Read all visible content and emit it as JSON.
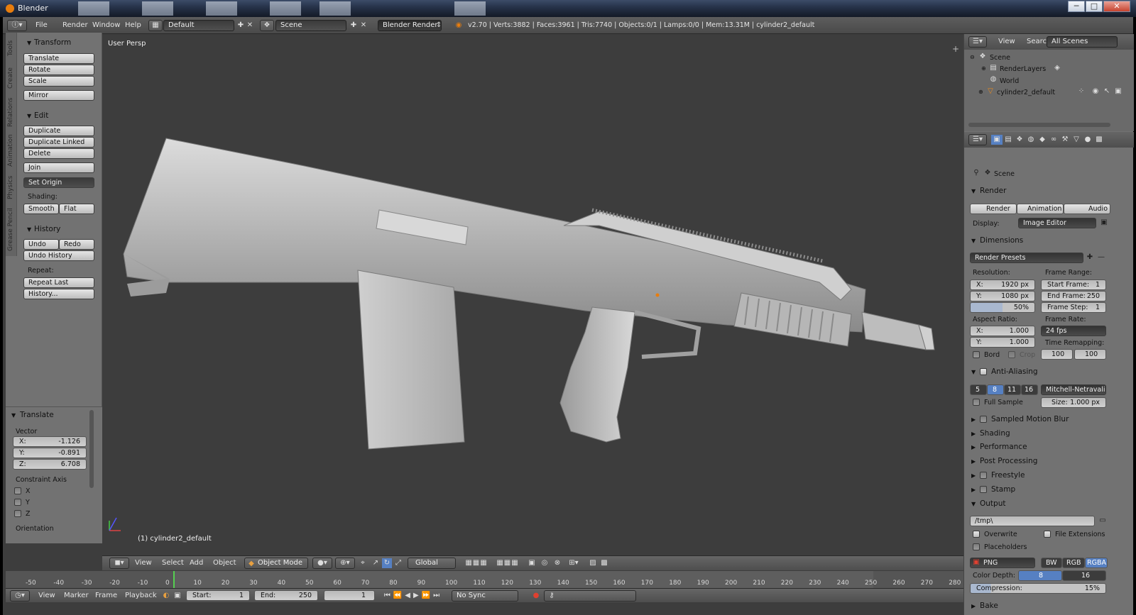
{
  "window": {
    "title": "Blender",
    "min": "─",
    "max": "□",
    "close": "✕"
  },
  "info": {
    "menus": [
      "File",
      "Render",
      "Window",
      "Help"
    ],
    "layout": "Default",
    "scene": "Scene",
    "engine": "Blender Render",
    "stats": "v2.70 | Verts:3882 | Faces:3961 | Tris:7740 | Objects:0/1 | Lamps:0/0 | Mem:13.31M | cylinder2_default"
  },
  "toolshelf": {
    "tabs": [
      "Tools",
      "Create",
      "Relations",
      "Animation",
      "Physics",
      "Grease Pencil"
    ],
    "transform": {
      "title": "Transform",
      "buttons": [
        "Translate",
        "Rotate",
        "Scale",
        "Mirror"
      ]
    },
    "edit": {
      "title": "Edit",
      "buttons": [
        "Duplicate",
        "Duplicate Linked",
        "Delete",
        "Join"
      ],
      "set_origin": "Set Origin",
      "shading_label": "Shading:",
      "smooth": "Smooth",
      "flat": "Flat"
    },
    "history": {
      "title": "History",
      "undo": "Undo",
      "redo": "Redo",
      "undo_history": "Undo History",
      "repeat_label": "Repeat:",
      "repeat_last": "Repeat Last",
      "history": "History..."
    }
  },
  "operator": {
    "title": "Translate",
    "vector_label": "Vector",
    "x": "X:",
    "xv": "-1.126",
    "y": "Y:",
    "yv": "-0.891",
    "z": "Z:",
    "zv": "6.708",
    "constraint_label": "Constraint Axis",
    "axes": [
      "X",
      "Y",
      "Z"
    ],
    "orientation": "Orientation"
  },
  "viewport": {
    "label": "User Persp",
    "object": "(1) cylinder2_default"
  },
  "viewheader": {
    "view": "View",
    "select": "Select",
    "add": "Add",
    "object": "Object",
    "mode": "Object Mode",
    "orientation": "Global"
  },
  "timeline": {
    "ticks": [
      "-50",
      "-40",
      "-30",
      "-20",
      "-10",
      "0",
      "10",
      "20",
      "30",
      "40",
      "50",
      "60",
      "70",
      "80",
      "90",
      "100",
      "110",
      "120",
      "130",
      "140",
      "150",
      "160",
      "170",
      "180",
      "190",
      "200",
      "210",
      "220",
      "230",
      "240",
      "250",
      "260",
      "270",
      "280"
    ],
    "view": "View",
    "marker": "Marker",
    "frame": "Frame",
    "playback": "Playback",
    "start": "Start:",
    "start_v": "1",
    "end": "End:",
    "end_v": "250",
    "current": "1",
    "sync": "No Sync"
  },
  "outliner": {
    "view": "View",
    "search": "Search",
    "scenes": "All Scenes",
    "items": [
      "Scene",
      "RenderLayers",
      "World",
      "cylinder2_default"
    ]
  },
  "properties": {
    "context": "Scene",
    "render": {
      "title": "Render",
      "render": "Render",
      "animation": "Animation",
      "audio": "Audio",
      "display_label": "Display:",
      "display": "Image Editor"
    },
    "dimensions": {
      "title": "Dimensions",
      "presets": "Render Presets",
      "resolution": "Resolution:",
      "rx": "X:",
      "rxv": "1920 px",
      "ry": "Y:",
      "ryv": "1080 px",
      "pct": "50%",
      "frame_range": "Frame Range:",
      "start": "Start Frame:",
      "start_v": "1",
      "end": "End Frame:",
      "end_v": "250",
      "step": "Frame Step:",
      "step_v": "1",
      "aspect": "Aspect Ratio:",
      "ax": "X:",
      "axv": "1.000",
      "ay": "Y:",
      "ayv": "1.000",
      "frame_rate": "Frame Rate:",
      "fps": "24 fps",
      "remap": "Time Remapping:",
      "remap_old": "100",
      "remap_new": "100",
      "bord": "Bord",
      "crop": "Crop"
    },
    "aa": {
      "title": "Anti-Aliasing",
      "samples": [
        "5",
        "8",
        "11",
        "16"
      ],
      "filter": "Mitchell-Netravali",
      "full_sample": "Full Sample",
      "size_label": "Size:",
      "size": "1.000 px"
    },
    "sections": [
      "Sampled Motion Blur",
      "Shading",
      "Performance",
      "Post Processing",
      "Freestyle",
      "Stamp"
    ],
    "output": {
      "title": "Output",
      "path": "/tmp\\",
      "overwrite": "Overwrite",
      "file_ext": "File Extensions",
      "placeholders": "Placeholders",
      "format": "PNG",
      "bw": "BW",
      "rgb": "RGB",
      "rgba": "RGBA",
      "depth_label": "Color Depth:",
      "d8": "8",
      "d16": "16",
      "compression_label": "Compression:",
      "compression": "15%"
    },
    "bake": "Bake"
  }
}
